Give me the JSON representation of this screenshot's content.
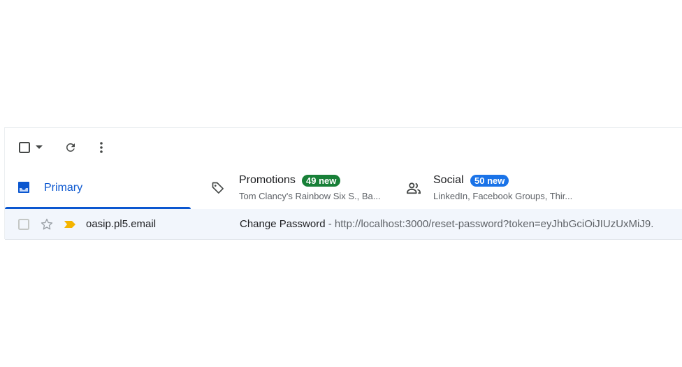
{
  "toolbar": {
    "select_all_icon": "checkbox-empty-icon",
    "select_menu_icon": "caret-down-icon",
    "refresh_icon": "refresh-icon",
    "more_icon": "more-vert-icon"
  },
  "tabs": [
    {
      "label": "Primary",
      "icon": "inbox-icon",
      "selected": true,
      "color": "#0b57d0"
    },
    {
      "label": "Promotions",
      "icon": "tag-icon",
      "badge": "49 new",
      "badge_color": "#188038",
      "subtitle": "Tom Clancy's Rainbow Six S., Ba..."
    },
    {
      "label": "Social",
      "icon": "people-icon",
      "badge": "50 new",
      "badge_color": "#1a73e8",
      "subtitle": "LinkedIn, Facebook Groups, Thir..."
    }
  ],
  "emails": [
    {
      "sender": "oasip.pl5.email",
      "subject": "Change Password",
      "separator": " - ",
      "snippet": "http://localhost:3000/reset-password?token=eyJhbGciOiJIUzUxMiJ9.",
      "starred": false,
      "important_marker": "importance-marker-icon",
      "important_color": "#f4b400"
    }
  ]
}
